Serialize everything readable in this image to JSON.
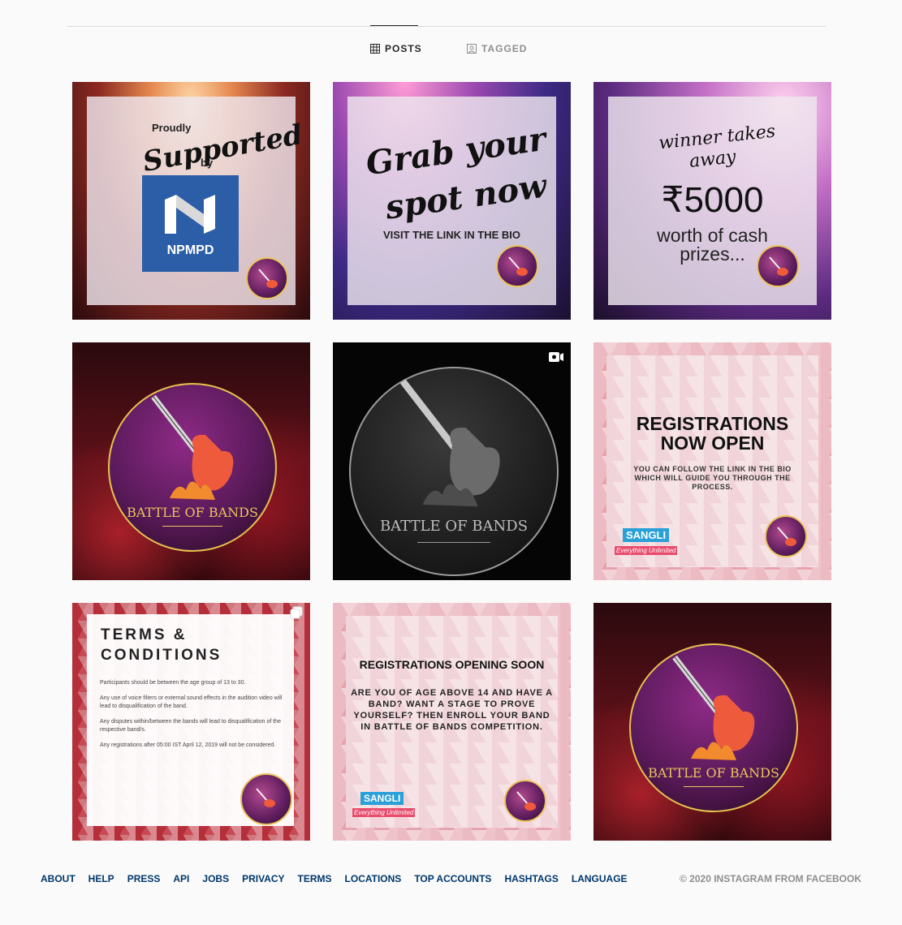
{
  "tabs": [
    {
      "label": "POSTS",
      "icon": "grid-icon",
      "active": true
    },
    {
      "label": "TAGGED",
      "icon": "tagged-user-icon",
      "active": false
    }
  ],
  "posts": [
    {
      "type": "sponsor",
      "line1": "Proudly",
      "line2": "Supported",
      "line3": "by",
      "sponsor_logo_text": "NPMPD"
    },
    {
      "type": "cta",
      "headline_line1": "Grab your",
      "headline_line2": "spot now",
      "subline": "VISIT THE LINK IN THE BIO"
    },
    {
      "type": "prize",
      "line1": "winner takes",
      "line2": "away",
      "amount": "₹5000",
      "line3": "worth of cash",
      "line4": "prizes..."
    },
    {
      "type": "logo",
      "logo_text": "BATTLE OF BANDS"
    },
    {
      "type": "video",
      "logo_text": "BATTLE OF BANDS",
      "indicator": "video-icon"
    },
    {
      "type": "announcement",
      "title_line1": "REGISTRATIONS",
      "title_line2": "NOW OPEN",
      "body": "YOU CAN FOLLOW THE LINK IN THE BIO WHICH WILL GUIDE YOU THROUGH THE PROCESS.",
      "partner_logo": "SANGLI",
      "partner_tagline": "Everything Unlimited"
    },
    {
      "type": "terms",
      "title_line1": "TERMS &",
      "title_line2": "CONDITIONS",
      "rules": [
        "Participants should be between the age group of 13 to 30.",
        "Any use of voice filters or external sound effects in the audition video will lead to disqualification of the band.",
        "Any disputes within/between the bands will lead to disqualification of the respective band/s.",
        "Any registrations after 05:00 IST April 12, 2019 will not be considered."
      ],
      "indicator": "carousel-icon"
    },
    {
      "type": "announcement2",
      "title": "REGISTRATIONS OPENING SOON",
      "body": "ARE YOU OF AGE ABOVE 14 AND HAVE A BAND? WANT A STAGE TO PROVE YOURSELF? THEN ENROLL YOUR BAND IN BATTLE OF BANDS COMPETITION.",
      "partner_logo": "SANGLI",
      "partner_tagline": "Everything Unlimited"
    },
    {
      "type": "logo",
      "logo_text": "BATTLE OF BANDS"
    }
  ],
  "footer": {
    "links": [
      "ABOUT",
      "HELP",
      "PRESS",
      "API",
      "JOBS",
      "PRIVACY",
      "TERMS",
      "LOCATIONS",
      "TOP ACCOUNTS",
      "HASHTAGS",
      "LANGUAGE"
    ],
    "copyright": "© 2020 INSTAGRAM FROM FACEBOOK"
  }
}
